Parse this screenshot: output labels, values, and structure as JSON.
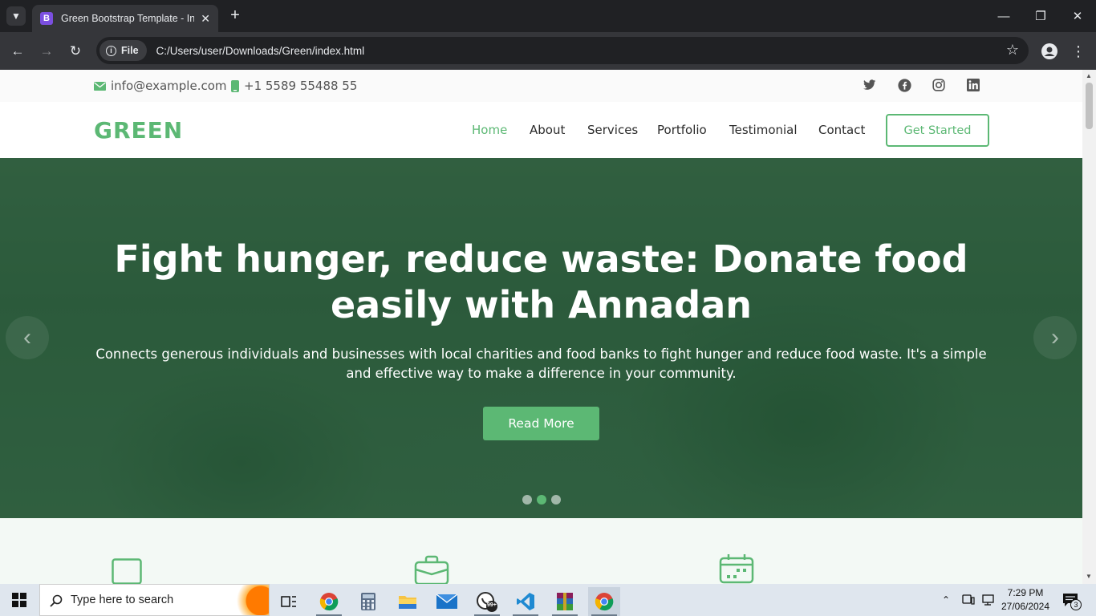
{
  "browser": {
    "tab_title": "Green Bootstrap Template - Index",
    "tab_favicon_letter": "B",
    "url_chip": "File",
    "url": "C:/Users/user/Downloads/Green/index.html"
  },
  "topbar": {
    "email": "info@example.com",
    "phone": "+1 5589 55488 55",
    "social_icons": [
      "twitter-icon",
      "facebook-icon",
      "instagram-icon",
      "linkedin-icon"
    ]
  },
  "header": {
    "logo": "GREEN",
    "nav": [
      "Home",
      "About",
      "Services",
      "Portfolio",
      "Testimonial",
      "Contact"
    ],
    "active_nav": "Home",
    "cta": "Get Started"
  },
  "hero": {
    "title": "Fight hunger, reduce waste: Donate food easily with Annadan",
    "text": "Connects generous individuals and businesses with local charities and food banks to fight hunger and reduce food waste. It's a simple and effective way to make a difference in your community.",
    "button": "Read More",
    "slides_count": 3,
    "active_slide": 2
  },
  "features": {
    "icons": [
      "laptop-icon",
      "briefcase-icon",
      "calendar-icon"
    ]
  },
  "taskbar": {
    "search_placeholder": "Type here to search",
    "time": "7:29 PM",
    "date": "27/06/2024",
    "whatsapp_badge": "99+",
    "notification_count": "3"
  },
  "colors": {
    "accent": "#5cb874",
    "hero_overlay": "#1e6437"
  }
}
